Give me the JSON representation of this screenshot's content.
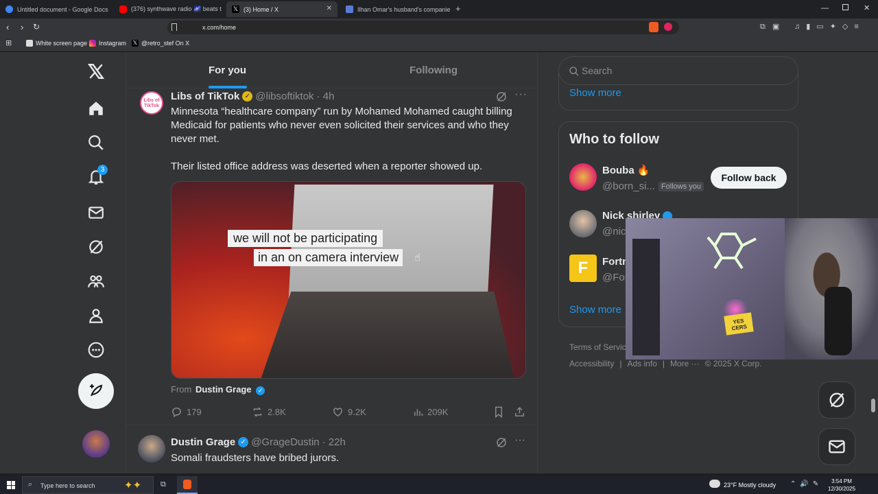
{
  "browser": {
    "tabs": [
      {
        "title": "Untitled document - Google Docs",
        "active": false
      },
      {
        "title": "(376) synthwave radio 🌌 beats t",
        "active": false
      },
      {
        "title": "(3) Home / X",
        "active": true
      },
      {
        "title": "Ilhan Omar's husband's companies s",
        "active": false
      }
    ],
    "url": "x.com/home",
    "bookmarks": [
      "White screen page",
      "Instagram",
      "@retro_stef On X"
    ]
  },
  "nav": {
    "notification_count": "3"
  },
  "feed": {
    "tabs": [
      "For you",
      "Following"
    ],
    "post1": {
      "author": "Libs of TikTok",
      "handle": "@libsoftiktok",
      "time": "· 4h",
      "text1": "Minnesota “healthcare company” run by Mohamed Mohamed caught billing Medicaid for patients who never even solicited their services and who they never met.",
      "text2": "Their listed office address was deserted when a reporter showed up.",
      "caption_line1": "we will not be participating",
      "caption_line2": "in an on camera interview",
      "from_label": "From",
      "from_name": "Dustin Grage",
      "replies": "179",
      "reposts": "2.8K",
      "likes": "9.2K",
      "views": "209K"
    },
    "post2": {
      "author": "Dustin Grage",
      "handle": "@GrageDustin",
      "time": "· 22h",
      "text": "Somali fraudsters have bribed jurors."
    }
  },
  "sidebar": {
    "search_placeholder": "Search",
    "show_more_top": "Show more",
    "who_to_follow_title": "Who to follow",
    "suggestions": [
      {
        "name": "Bouba 🔥",
        "handle": "@born_si...",
        "badge": "Follows you",
        "button": "Follow back"
      },
      {
        "name": "Nick shirley",
        "handle": "@nic",
        "badge": "",
        "button": ""
      },
      {
        "name": "Fortn",
        "handle": "@For",
        "badge": "",
        "button": ""
      }
    ],
    "show_more_bottom": "Show more",
    "footer": {
      "terms": "Terms of Service",
      "accessibility": "Accessibility",
      "ads": "Ads info",
      "more": "More ···",
      "copyright": "© 2025 X Corp."
    }
  },
  "taskbar": {
    "search_placeholder": "Type here to search",
    "weather": "23°F  Mostly cloudy",
    "time": "3:54 PM",
    "date": "12/30/2025"
  },
  "webcam": {
    "sign_text": "YES\nCERS"
  },
  "colors": {
    "accent": "#1d9bf0",
    "page_bg": "#333436",
    "verified_gold": "#e2b719"
  }
}
